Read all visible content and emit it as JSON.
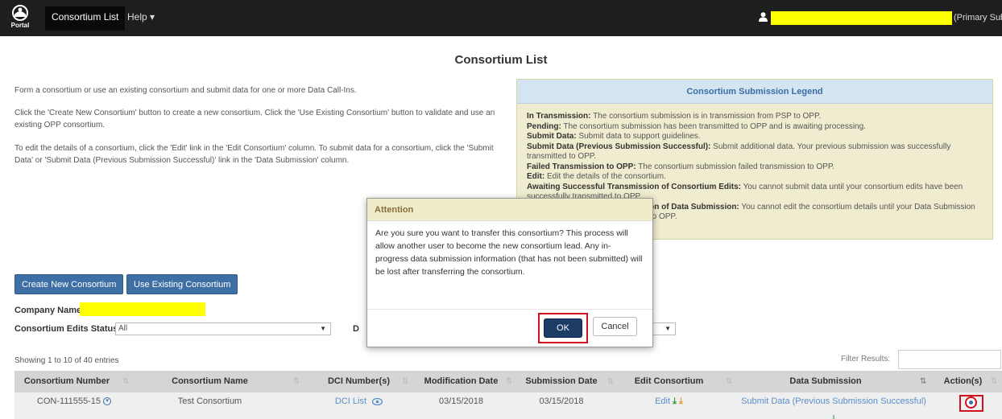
{
  "navbar": {
    "logo_text": "Portal",
    "active_tab": "Consortium List",
    "help_label": "Help ▾",
    "user_role": "(Primary Submitter)"
  },
  "page": {
    "title": "Consortium List",
    "intro": [
      "Form a consortium or use an existing consortium and submit data for one or more Data Call-Ins.",
      "Click the 'Create New Consortium' button to create a new consortium. Click the 'Use Existing Consortium' button to validate and use an existing OPP consortium.",
      "To edit the details of a consortium, click the 'Edit' link in the 'Edit Consortium' column. To submit data for a consortium, click the 'Submit Data' or 'Submit Data (Previous Submission Successful)' link in the 'Data Submission' column."
    ]
  },
  "legend": {
    "title": "Consortium Submission Legend",
    "items": [
      {
        "term": "In Transmission:",
        "desc": " The consortium submission is in transmission from PSP to OPP."
      },
      {
        "term": "Pending:",
        "desc": " The consortium submission has been transmitted to OPP and is awaiting processing."
      },
      {
        "term": "Submit Data:",
        "desc": " Submit data to support guidelines."
      },
      {
        "term": "Submit Data (Previous Submission Successful):",
        "desc": " Submit additional data. Your previous submission was successfully transmitted to OPP."
      },
      {
        "term": "Failed Transmission to OPP:",
        "desc": " The consortium submission failed transmission to OPP."
      },
      {
        "term": "Edit:",
        "desc": " Edit the details of the consortium."
      },
      {
        "term": "Awaiting Successful Transmission of Consortium Edits:",
        "desc": " You cannot submit data until your consortium edits have been successfully transmitted to OPP."
      },
      {
        "term": "Awaiting Successful Transmission of Data Submission:",
        "desc": " You cannot edit the consortium details until your Data Submission has been successfully transmitted to OPP."
      }
    ]
  },
  "buttons": {
    "create": "Create New Consortium",
    "use_existing": "Use Existing Consortium"
  },
  "filters": {
    "company_label": "Company Name:",
    "edits_status_label": "Consortium Edits Status",
    "edits_status_value": "All",
    "second_label_initial": "D"
  },
  "table": {
    "showing": "Showing 1 to 10 of 40 entries",
    "filter_label": "Filter Results:",
    "columns": [
      "Consortium Number",
      "Consortium Name",
      "DCI Number(s)",
      "Modification Date",
      "Submission Date",
      "Edit Consortium",
      "Data Submission",
      "Action(s)"
    ],
    "rows": [
      {
        "number": "CON-111555-15",
        "name": "Test Consortium",
        "dci": "DCI List",
        "modified": "03/15/2018",
        "submitted": "03/15/2018",
        "edit": "Edit",
        "submission": "Submit Data (Previous Submission Successful)"
      }
    ]
  },
  "modal": {
    "title": "Attention",
    "message": "Are you sure you want to transfer this consortium? This process will allow another user to become the new consortium lead. Any in-progress data submission information (that has not been submitted) will be lost after transferring the consortium.",
    "ok": "OK",
    "cancel": "Cancel"
  },
  "colors": {
    "navbar": "#1e1e1e",
    "primary_button": "#3d6fa5",
    "highlight": "#ffff00",
    "annotation_red": "#d0101e",
    "ok_button": "#1c3c66"
  },
  "icons": [
    "portal-logo-icon",
    "user-icon",
    "circle-chevron-down-icon",
    "eye-icon",
    "download-icon",
    "info-icon",
    "transfer-icon"
  ]
}
